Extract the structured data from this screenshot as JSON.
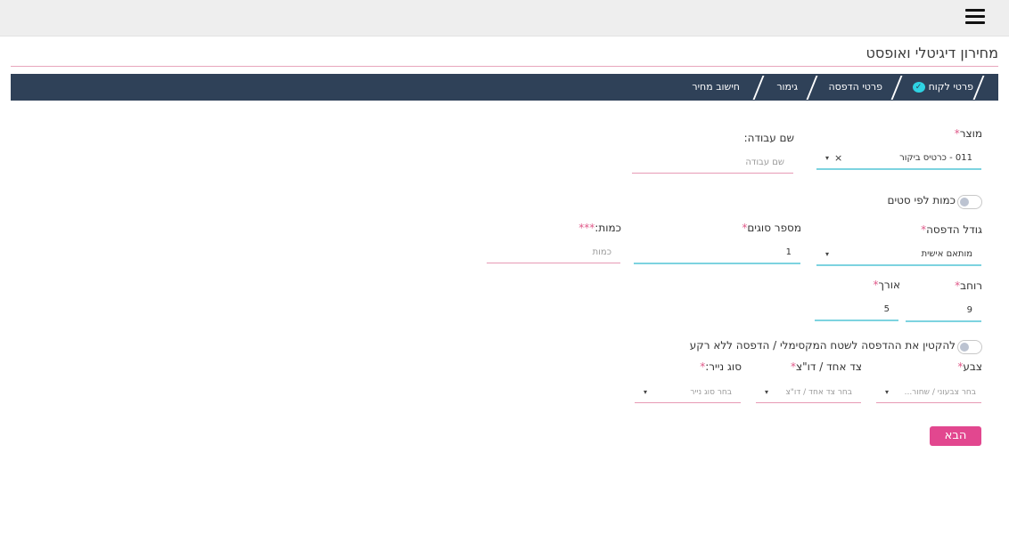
{
  "topbar": {
    "menu_icon": "hamburger-icon"
  },
  "page": {
    "title": "מחירון דיגיטלי ואופסט"
  },
  "steps": [
    {
      "label": "פרטי לקוח",
      "done": true
    },
    {
      "label": "פרטי הדפסה"
    },
    {
      "label": "גימור"
    },
    {
      "label": "חישוב מחיר"
    }
  ],
  "form": {
    "product": {
      "label": "מוצר",
      "required_mark": "*",
      "value": "011 - כרטיס ביקור",
      "clear": "×",
      "caret": "▾"
    },
    "job_name": {
      "label": "שם עבודה:",
      "placeholder": "שם עבודה"
    },
    "qty_by_sets": {
      "label": "כמות לפי סטים"
    },
    "print_size": {
      "label": "גודל הדפסה",
      "required_mark": "*",
      "value": "מותאם אישית",
      "caret": "▾"
    },
    "num_types": {
      "label": "מספר סוגים",
      "required_mark": "*",
      "value": "1"
    },
    "quantity": {
      "label": "כמות:",
      "required_mark": "***",
      "placeholder": "כמות"
    },
    "width": {
      "label": "רוחב",
      "required_mark": "*",
      "value": "9"
    },
    "length": {
      "label": "אורך",
      "required_mark": "*",
      "value": "5"
    },
    "shrink_toggle": {
      "label": "להקטין את ההדפסה לשטח המקסימלי / הדפסה ללא רקע"
    },
    "color": {
      "label": "צבע",
      "required_mark": "*",
      "placeholder": "בחר צבעוני / שחור...",
      "caret": "▾"
    },
    "sides": {
      "label": "צד אחד / דו\"צ",
      "required_mark": "*",
      "placeholder": "בחר צד אחד / דו\"צ",
      "caret": "▾"
    },
    "paper_type": {
      "label": "סוג נייר:",
      "required_mark": "*",
      "placeholder": "בחר סוג נייר",
      "caret": "▾"
    }
  },
  "actions": {
    "next_label": "הבא"
  },
  "colors": {
    "accent_pink": "#e2478f",
    "nav_bg": "#2f4158",
    "underline_blue": "#7dd3e0"
  }
}
